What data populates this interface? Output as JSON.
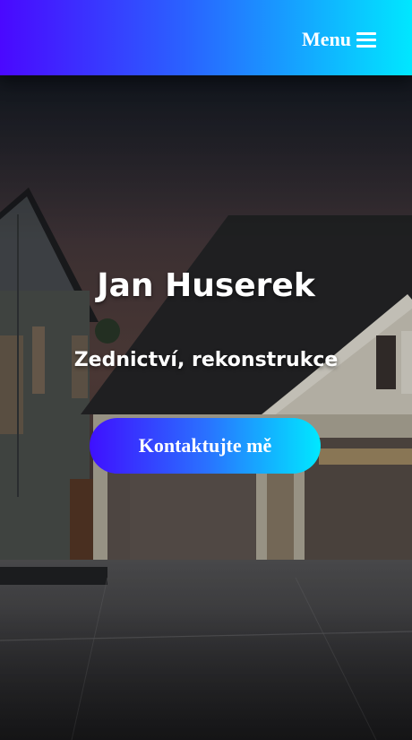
{
  "nav": {
    "menu_label": "Menu",
    "menu_icon": "hamburger-icon"
  },
  "hero": {
    "name": "Jan Huserek",
    "subtitle": "Zednictví, rekonstrukce",
    "cta_label": "Kontaktujte mě",
    "background": "house-exterior-photo"
  },
  "colors": {
    "gradient_start": "#4a08ff",
    "gradient_end": "#00e7ff",
    "text": "#ffffff"
  }
}
